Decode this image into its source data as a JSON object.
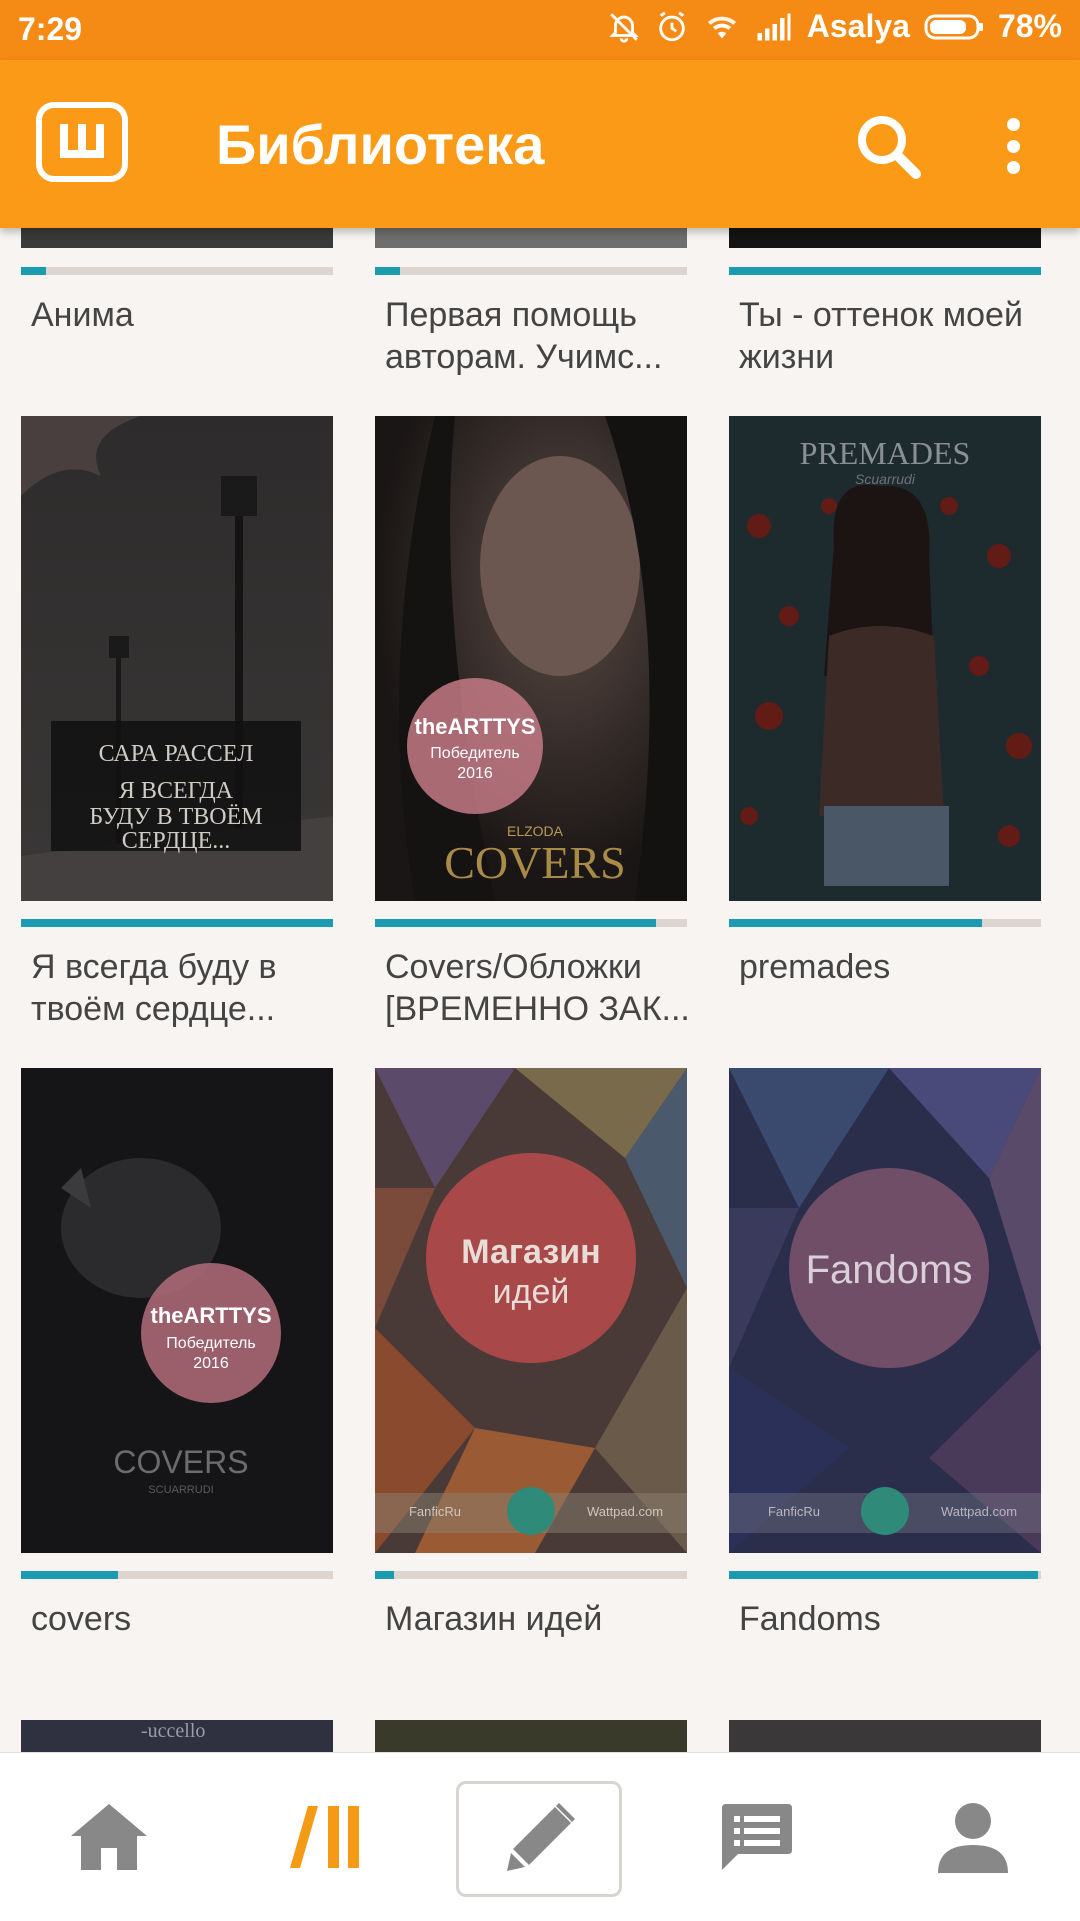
{
  "status_bar": {
    "time": "7:29",
    "carrier": "Asalya",
    "battery": "78%",
    "battery_level": 0.78,
    "icons": [
      "mute-bell-icon",
      "alarm-icon",
      "wifi-icon",
      "signal-icon",
      "battery-icon"
    ]
  },
  "app_bar": {
    "logo_icon": "wattpad-logo-icon",
    "title": "Библиотека",
    "search_icon": "search-icon",
    "more_icon": "more-vert-icon"
  },
  "colors": {
    "status_bar": "#f58a14",
    "app_bar": "#fa9a16",
    "progress_fill": "#1a9bb0",
    "progress_track": "#ddd6d0",
    "nav_active": "#f59a14",
    "nav_inactive": "#888888"
  },
  "library": {
    "top_row": [
      {
        "title": "Анима",
        "progress": 0.08
      },
      {
        "title": "Первая помощь авторам. Учимс...",
        "progress": 0.08
      },
      {
        "title": "Ты - оттенок моей жизни",
        "progress": 1.0
      }
    ],
    "row_2": [
      {
        "title": "Я всегда буду в твоём сердце...",
        "progress": 1.0,
        "cover_text": {
          "author": "САРА РАССЕЛ",
          "line1": "Я ВСЕГДА",
          "line2": "БУДУ В ТВОЁМ",
          "line3": "СЕРДЦЕ..."
        }
      },
      {
        "title": "Covers/Обложки [ВРЕМЕННО ЗАК...",
        "progress": 0.9,
        "cover_text": {
          "badge1": "theARTTYS",
          "badge2": "Победитель",
          "badge3": "2016",
          "brand": "ELZODA",
          "main": "COVERS"
        }
      },
      {
        "title": "premades",
        "progress": 0.81,
        "cover_text": {
          "main": "PREMADES",
          "sub": "Scuarrudi"
        }
      }
    ],
    "row_3": [
      {
        "title": "covers",
        "progress": 0.31,
        "cover_text": {
          "badge1": "theARTTYS",
          "badge2": "Победитель",
          "badge3": "2016",
          "main": "COVERS",
          "sub": "SCUARRUDI"
        }
      },
      {
        "title": "Магазин идей",
        "progress": 0.06,
        "cover_text": {
          "line1": "Магазин",
          "line2": "идей",
          "left": "FanficRu",
          "right": "Wattpad.com"
        }
      },
      {
        "title": "Fandoms",
        "progress": 0.99,
        "cover_text": {
          "main": "Fandoms",
          "left": "FanficRu",
          "right": "Wattpad.com"
        }
      }
    ],
    "row_4_peek": [
      "-uccello"
    ]
  },
  "bottom_nav": {
    "items": [
      {
        "icon": "home-icon",
        "active": false
      },
      {
        "icon": "library-icon",
        "active": true
      },
      {
        "icon": "pencil-icon",
        "active": false
      },
      {
        "icon": "messages-icon",
        "active": false
      },
      {
        "icon": "profile-icon",
        "active": false
      }
    ]
  }
}
